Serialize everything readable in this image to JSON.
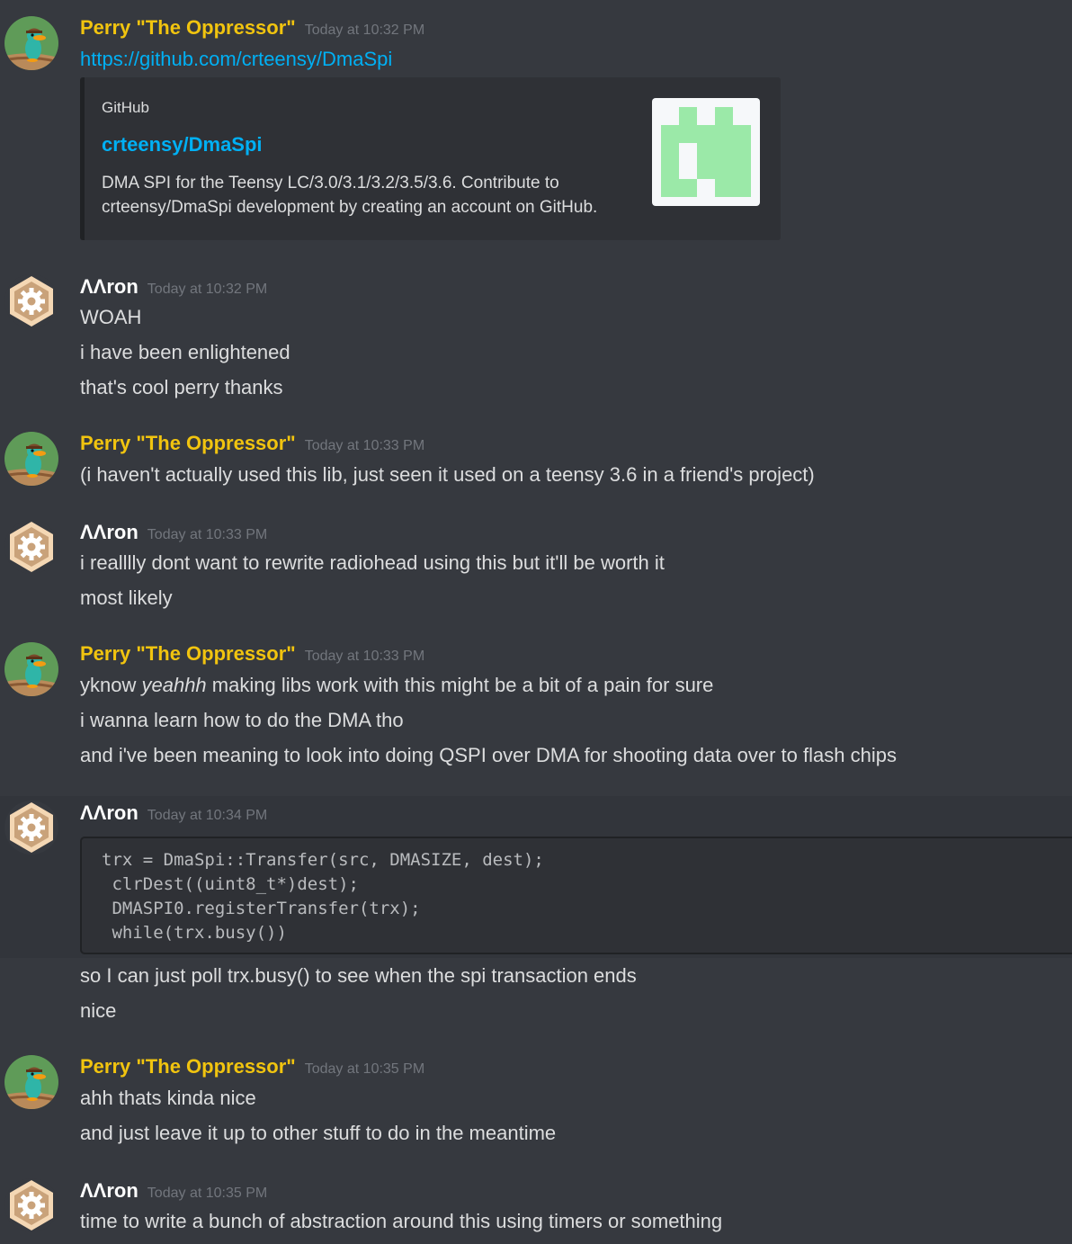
{
  "colors": {
    "background": "#36393f",
    "perry_name": "#f1c40f",
    "aaron_name": "#ffffff",
    "link": "#00b0f4",
    "timestamp": "#72767d",
    "embed_bg": "#2f3136",
    "thumb_green": "#9be9a8"
  },
  "users": {
    "perry": {
      "name": "Perry \"The Oppressor\"",
      "avatar_icon": "perry-platypus-avatar-icon"
    },
    "aaron": {
      "name": "ΛΛron",
      "avatar_icon": "gear-hexagon-avatar-icon"
    }
  },
  "messages": [
    {
      "author": "Perry \"The Oppressor\"",
      "timestamp": "Today at 10:32 PM",
      "link": "https://github.com/crteensy/DmaSpi",
      "embed": {
        "provider": "GitHub",
        "title": "crteensy/DmaSpi",
        "description_line1": "DMA SPI for the Teensy LC/3.0/3.1/3.2/3.5/3.6. Contribute to",
        "description_line2": "crteensy/DmaSpi development by creating an account on GitHub.",
        "thumbnail_icon": "github-identicon-icon"
      }
    },
    {
      "author": "ΛΛron",
      "timestamp": "Today at 10:32 PM",
      "lines": [
        "WOAH",
        "i have been enlightened",
        "that's cool perry thanks"
      ]
    },
    {
      "author": "Perry \"The Oppressor\"",
      "timestamp": "Today at 10:33 PM",
      "lines": [
        "(i haven't actually used this lib, just seen it used on a teensy 3.6 in a friend's project)"
      ]
    },
    {
      "author": "ΛΛron",
      "timestamp": "Today at 10:33 PM",
      "lines": [
        "i realllly dont want to rewrite radiohead using this but it'll be worth it",
        "most likely"
      ]
    },
    {
      "author": "Perry \"The Oppressor\"",
      "timestamp": "Today at 10:33 PM",
      "line1_pre": "yknow ",
      "line1_em": "yeahhh",
      "line1_post": " making libs work with this might be a bit of a pain for sure",
      "lines": [
        "i wanna learn how to do the DMA tho",
        "and i've been meaning to look into doing QSPI over DMA for shooting data over to flash chips"
      ]
    },
    {
      "author": "ΛΛron",
      "timestamp": "Today at 10:34 PM",
      "code": "trx = DmaSpi::Transfer(src, DMASIZE, dest);\n clrDest((uint8_t*)dest);\n DMASPI0.registerTransfer(trx);\n while(trx.busy())",
      "lines": [
        "so I can just poll trx.busy() to see when the spi transaction ends",
        "nice"
      ]
    },
    {
      "author": "Perry \"The Oppressor\"",
      "timestamp": "Today at 10:35 PM",
      "lines": [
        "ahh thats kinda nice",
        "and just leave it up to other stuff to do in the meantime"
      ]
    },
    {
      "author": "ΛΛron",
      "timestamp": "Today at 10:35 PM",
      "lines": [
        "time to write a bunch of abstraction around this using timers or something"
      ]
    }
  ]
}
